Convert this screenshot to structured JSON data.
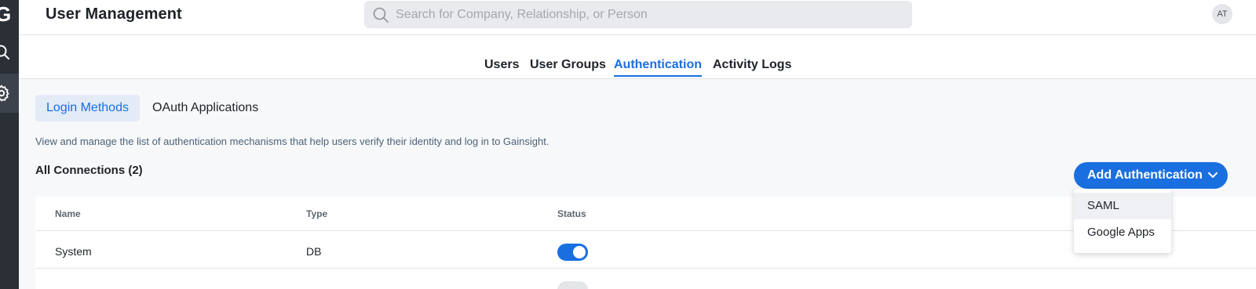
{
  "app": {
    "logo_letter": "G"
  },
  "header": {
    "title": "User Management",
    "search": {
      "placeholder": "Search for Company, Relationship, or Person",
      "value": ""
    },
    "avatar_initials": "AT"
  },
  "tabs": [
    {
      "label": "Users",
      "active": false
    },
    {
      "label": "User Groups",
      "active": false
    },
    {
      "label": "Authentication",
      "active": true
    },
    {
      "label": "Activity Logs",
      "active": false
    }
  ],
  "subtabs": [
    {
      "label": "Login Methods",
      "active": true
    },
    {
      "label": "OAuth Applications",
      "active": false
    }
  ],
  "description": "View and manage the list of authentication mechanisms that help users verify their identity and log in to Gainsight.",
  "connections": {
    "title": "All Connections (2)",
    "add_button_label": "Add Authentication",
    "columns": [
      "Name",
      "Type",
      "Status"
    ],
    "rows": [
      {
        "name": "System",
        "type": "DB",
        "status_enabled": true
      }
    ]
  },
  "add_menu": {
    "items": [
      "SAML",
      "Google Apps"
    ]
  },
  "colors": {
    "accent": "#1a6fe0",
    "rail": "#2b2f36"
  }
}
